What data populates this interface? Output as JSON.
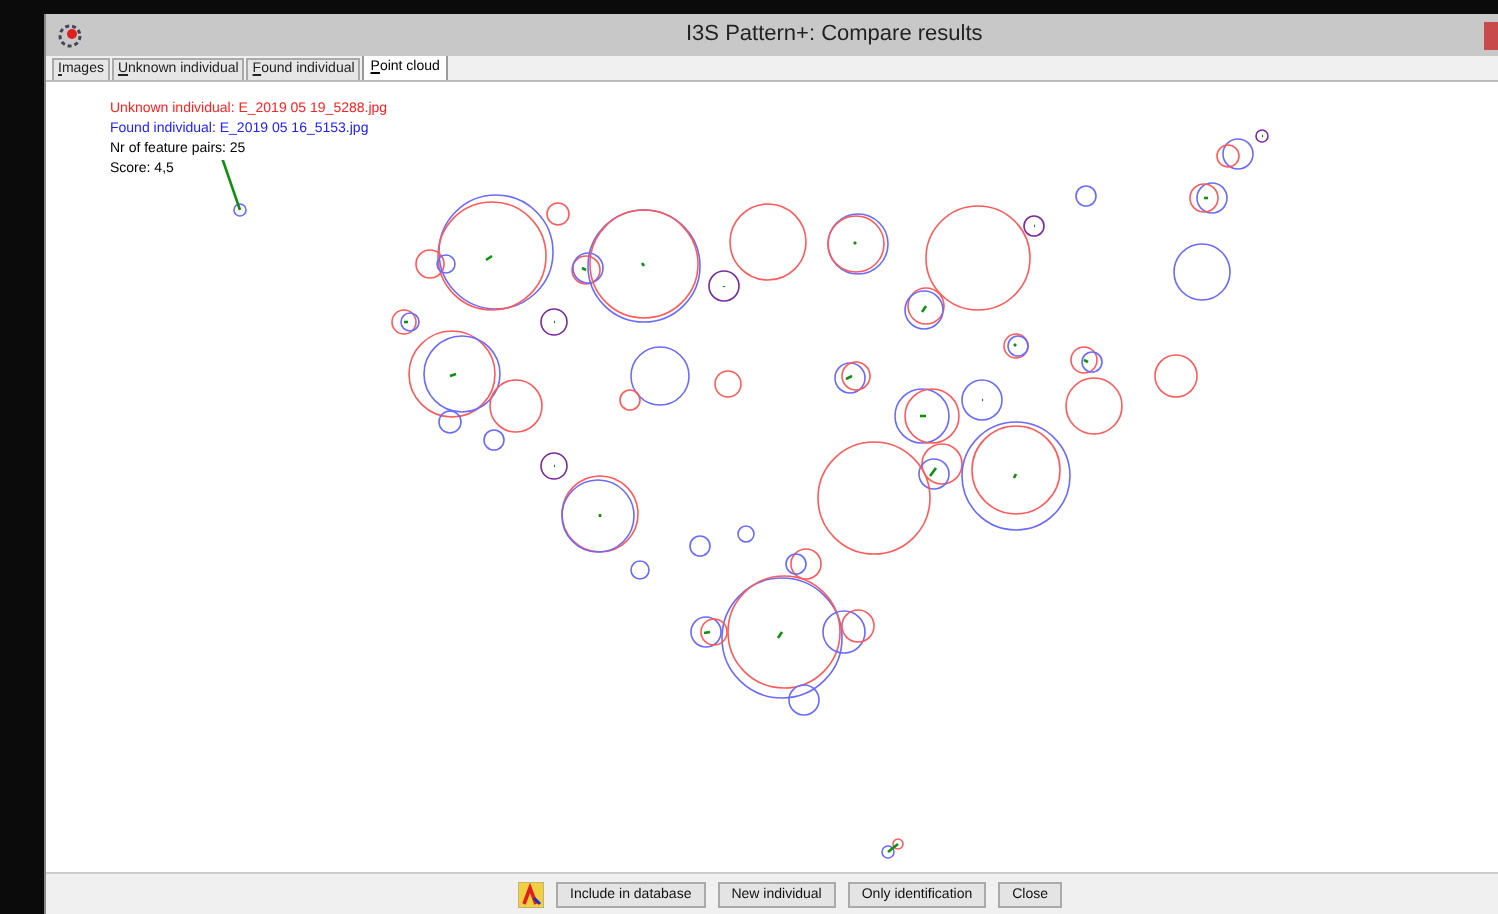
{
  "window": {
    "title": "I3S Pattern+: Compare results"
  },
  "tabs": [
    {
      "label": "Images",
      "selected": false
    },
    {
      "label": "Unknown individual",
      "selected": false
    },
    {
      "label": "Found individual",
      "selected": false
    },
    {
      "label": "Point cloud",
      "selected": true
    }
  ],
  "info": [
    {
      "kind": "unknown",
      "text": "Unknown individual: E_2019 05 19_5288.jpg"
    },
    {
      "kind": "found",
      "text": "Found individual: E_2019 05 16_5153.jpg"
    },
    {
      "kind": "plain",
      "text": "Nr of feature pairs: 25"
    },
    {
      "kind": "plain",
      "text": "Score: 4,5"
    }
  ],
  "buttons": [
    "Include in database",
    "New individual",
    "Only identification",
    "Close"
  ]
}
